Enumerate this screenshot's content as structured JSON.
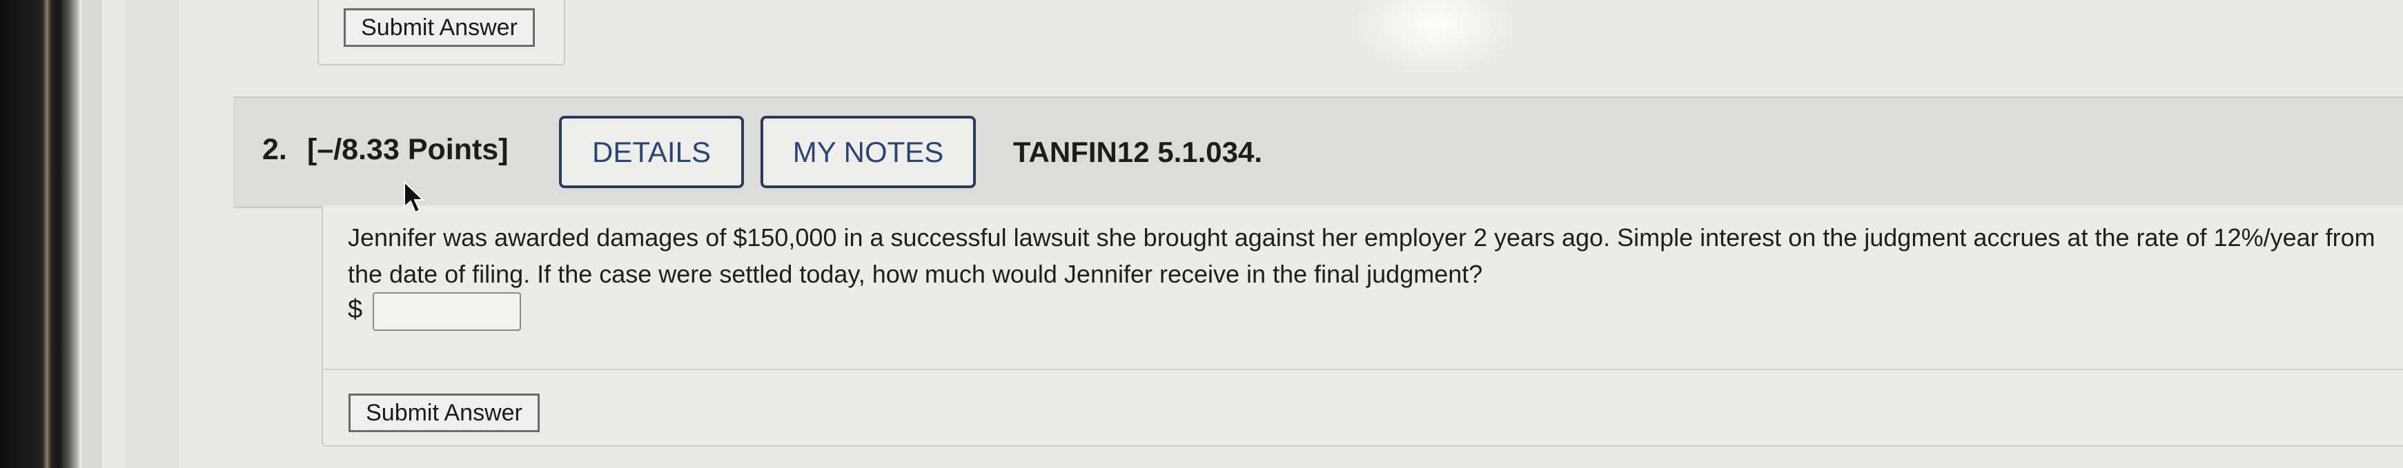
{
  "previous_question": {
    "submit_label": "Submit Answer"
  },
  "question": {
    "number": "2.",
    "points": "[–/8.33 Points]",
    "details_label": "DETAILS",
    "notes_label": "MY NOTES",
    "code": "TANFIN12 5.1.034.",
    "text": "Jennifer was awarded damages of $150,000 in a successful lawsuit she brought against her employer 2 years ago. Simple interest on the judgment accrues at the rate of 12%/year from the date of filing. If the case were settled today, how much would Jennifer receive in the final judgment?",
    "currency_symbol": "$",
    "answer_value": "",
    "submit_label": "Submit Answer"
  },
  "colors": {
    "tab_border": "#2e3b55",
    "tab_text": "#2c4470",
    "header_bg": "#dcdcda",
    "page_bg": "#e9e9e7"
  },
  "icons": {
    "cursor": "mouse-pointer-icon"
  }
}
